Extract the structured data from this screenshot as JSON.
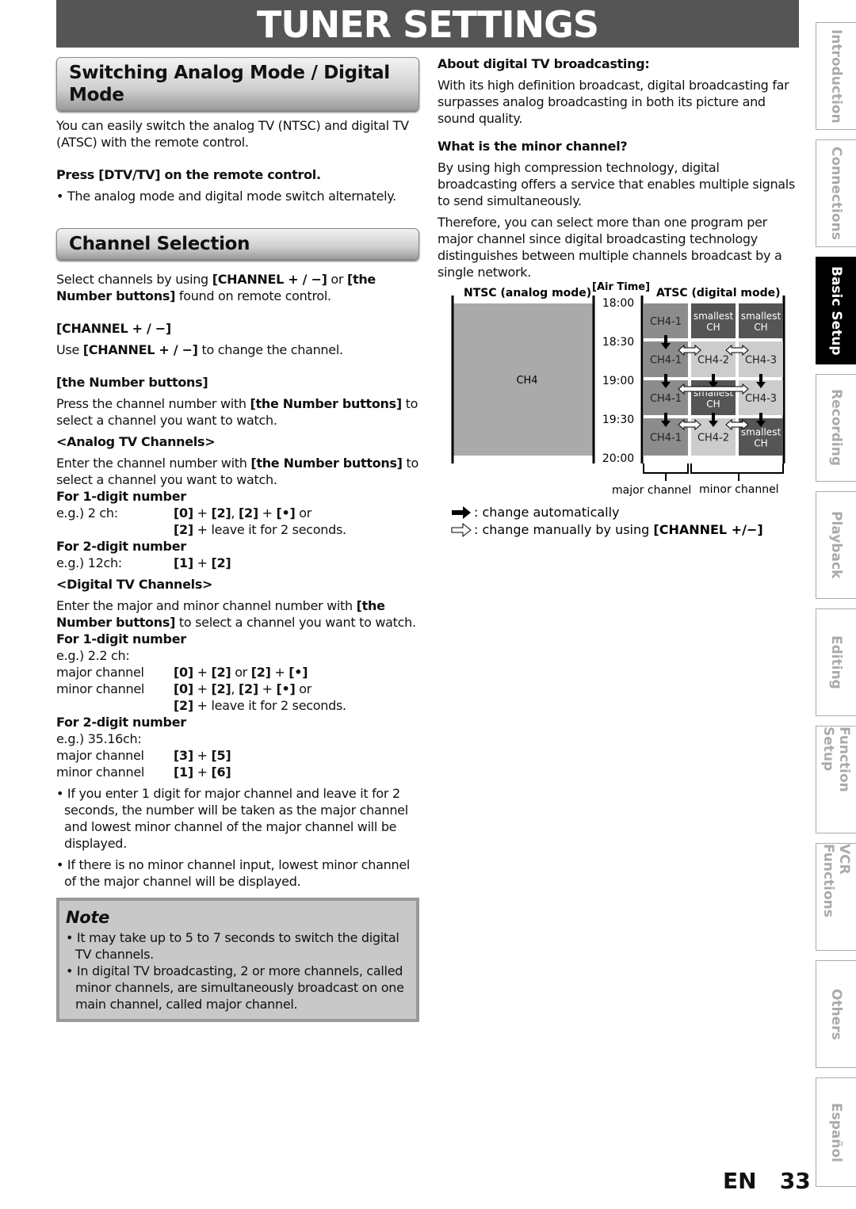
{
  "title": "TUNER SETTINGS",
  "left": {
    "sec1": "Switching Analog Mode / Digital Mode",
    "sec2": "Channel Selection",
    "blocks": [
      {
        "c": "blk",
        "segs": [
          {
            "t": "You can easily switch the analog TV (NTSC) and digital TV (ATSC) with the remote control."
          }
        ]
      },
      {
        "c": "gap20",
        "segs": [
          {
            "t": "Press [DTV/TV] on the remote control.",
            "b": true
          }
        ]
      },
      {
        "c": "gap6 bul",
        "segs": [
          {
            "t": "• The analog mode and digital mode switch alternately."
          }
        ]
      },
      {
        "sec": "sec2",
        "c": "gap30"
      },
      {
        "c": "gap14",
        "segs": [
          {
            "t": "Select channels by using "
          },
          {
            "t": "[CHANNEL + / −]",
            "b": true
          },
          {
            "t": " or "
          },
          {
            "t": "[the Number buttons]",
            "b": true
          },
          {
            "t": " found on remote control."
          }
        ]
      },
      {
        "c": "gap20",
        "segs": [
          {
            "t": "[CHANNEL + / −]",
            "b": true
          }
        ]
      },
      {
        "c": "gap6",
        "segs": [
          {
            "t": "Use "
          },
          {
            "t": "[CHANNEL + / −]",
            "b": true
          },
          {
            "t": " to change the channel."
          }
        ]
      },
      {
        "c": "gap20",
        "segs": [
          {
            "t": "[the Number buttons]",
            "b": true
          }
        ]
      },
      {
        "c": "gap6",
        "segs": [
          {
            "t": "Press the channel number with "
          },
          {
            "t": "[the Number buttons]",
            "b": true
          },
          {
            "t": " to select a channel you want to watch."
          }
        ]
      },
      {
        "c": "gap6",
        "segs": [
          {
            "t": "<Analog TV Channels>",
            "b": true
          }
        ]
      },
      {
        "c": "gap6",
        "segs": [
          {
            "t": "Enter the channel number with "
          },
          {
            "t": "[the Number buttons]",
            "b": true
          },
          {
            "t": " to select a channel you want to watch."
          }
        ]
      },
      {
        "c": "",
        "segs": [
          {
            "t": "For 1-digit number",
            "b": true
          }
        ]
      },
      {
        "row": "e.g.) 2 ch:",
        "segs": [
          {
            "t": "[0]",
            "b": true
          },
          {
            "t": " + "
          },
          {
            "t": "[2]",
            "b": true
          },
          {
            "t": ", "
          },
          {
            "t": "[2]",
            "b": true
          },
          {
            "t": " + "
          },
          {
            "t": "[•]",
            "b": true
          },
          {
            "t": " or"
          }
        ]
      },
      {
        "c": "ind",
        "segs": [
          {
            "t": "[2]",
            "b": true
          },
          {
            "t": " + leave it for 2 seconds."
          }
        ]
      },
      {
        "c": "",
        "segs": [
          {
            "t": "For 2-digit number",
            "b": true
          }
        ]
      },
      {
        "row": "e.g.) 12ch:",
        "segs": [
          {
            "t": "[1]",
            "b": true
          },
          {
            "t": " + "
          },
          {
            "t": "[2]",
            "b": true
          }
        ]
      },
      {
        "c": "gap6",
        "segs": [
          {
            "t": "<Digital TV Channels>",
            "b": true
          }
        ]
      },
      {
        "c": "gap6",
        "segs": [
          {
            "t": "Enter the major and minor channel number with "
          },
          {
            "t": "[the Number buttons]",
            "b": true
          },
          {
            "t": " to select a channel you want to watch."
          }
        ]
      },
      {
        "c": "",
        "segs": [
          {
            "t": "For 1-digit number",
            "b": true
          }
        ]
      },
      {
        "c": "",
        "segs": [
          {
            "t": "e.g.) 2.2 ch:"
          }
        ]
      },
      {
        "row": "major channel",
        "segs": [
          {
            "t": "[0]",
            "b": true
          },
          {
            "t": " + "
          },
          {
            "t": "[2]",
            "b": true
          },
          {
            "t": " or "
          },
          {
            "t": "[2]",
            "b": true
          },
          {
            "t": " + "
          },
          {
            "t": "[•]",
            "b": true
          }
        ]
      },
      {
        "row": "minor channel",
        "segs": [
          {
            "t": "[0]",
            "b": true
          },
          {
            "t": " + "
          },
          {
            "t": "[2]",
            "b": true
          },
          {
            "t": ", "
          },
          {
            "t": "[2]",
            "b": true
          },
          {
            "t": " + "
          },
          {
            "t": "[•]",
            "b": true
          },
          {
            "t": " or"
          }
        ]
      },
      {
        "c": "ind",
        "segs": [
          {
            "t": "[2]",
            "b": true
          },
          {
            "t": " + leave it for 2 seconds."
          }
        ]
      },
      {
        "c": "",
        "segs": [
          {
            "t": "For 2-digit number",
            "b": true
          }
        ]
      },
      {
        "c": "",
        "segs": [
          {
            "t": "e.g.) 35.16ch:"
          }
        ]
      },
      {
        "row": "major channel",
        "segs": [
          {
            "t": "[3]",
            "b": true
          },
          {
            "t": " + "
          },
          {
            "t": "[5]",
            "b": true
          }
        ]
      },
      {
        "row": "minor channel",
        "segs": [
          {
            "t": "[1]",
            "b": true
          },
          {
            "t": " + "
          },
          {
            "t": "[6]",
            "b": true
          }
        ]
      },
      {
        "c": "gap6 bul",
        "segs": [
          {
            "t": "• If you enter 1 digit for major channel and leave it for 2 seconds, the number will be taken as the major channel and lowest minor channel of the major channel will be displayed."
          }
        ]
      },
      {
        "c": "gap6 bul",
        "segs": [
          {
            "t": "• If there is no minor channel input, lowest minor channel of the major channel will be displayed."
          }
        ]
      }
    ],
    "note": {
      "title": "Note",
      "items": [
        "• It may take up to 5 to 7 seconds to switch the digital TV channels.",
        "• In digital TV broadcasting, 2 or more channels, called minor channels, are simultaneously broadcast on one main channel, called major channel."
      ]
    }
  },
  "right": {
    "blocks": [
      {
        "c": "",
        "segs": [
          {
            "t": "About digital TV broadcasting:",
            "b": true
          }
        ]
      },
      {
        "c": "gap6",
        "segs": [
          {
            "t": "With its high definition broadcast, digital broadcasting far surpasses analog broadcasting in both its picture and sound quality."
          }
        ]
      },
      {
        "c": "gap14",
        "segs": [
          {
            "t": "What is the minor channel?",
            "b": true
          }
        ]
      },
      {
        "c": "gap6",
        "segs": [
          {
            "t": "By using high compression technology, digital broadcasting offers a service that enables multiple signals to send simultaneously."
          }
        ]
      },
      {
        "c": "gap6",
        "segs": [
          {
            "t": "Therefore, you can select more than one program per major channel since digital broadcasting technology distinguishes between multiple channels broadcast by a single network."
          }
        ]
      }
    ]
  },
  "diagram": {
    "ntsc_label": "NTSC (analog mode)",
    "air_label": "[Air Time]",
    "atsc_label": "ATSC (digital mode)",
    "ntsc_channel": "CH4",
    "times": [
      "18:00",
      "18:30",
      "19:00",
      "19:30",
      "20:00"
    ],
    "grid": [
      [
        "CH4-1",
        "smallest CH",
        "smallest CH"
      ],
      [
        "CH4-1",
        "CH4-2",
        "CH4-3"
      ],
      [
        "CH4-1",
        "smallest CH",
        "CH4-3"
      ],
      [
        "CH4-1",
        "CH4-2",
        "smallest CH"
      ]
    ],
    "major_label": "major channel",
    "minor_label": "minor channel",
    "legend_auto": ": change automatically",
    "legend_manual": ": change manually by using ",
    "legend_manual_key": "[CHANNEL +/−]"
  },
  "tabs": [
    {
      "label": "Introduction",
      "active": false
    },
    {
      "label": "Connections",
      "active": false
    },
    {
      "label": "Basic Setup",
      "active": true
    },
    {
      "label": "Recording",
      "active": false
    },
    {
      "label": "Playback",
      "active": false
    },
    {
      "label": "Editing",
      "active": false
    },
    {
      "label": "Function Setup",
      "active": false
    },
    {
      "label": "VCR Functions",
      "active": false
    },
    {
      "label": "Others",
      "active": false
    },
    {
      "label": "Español",
      "active": false
    }
  ],
  "page": {
    "lang": "EN",
    "number": "33"
  }
}
